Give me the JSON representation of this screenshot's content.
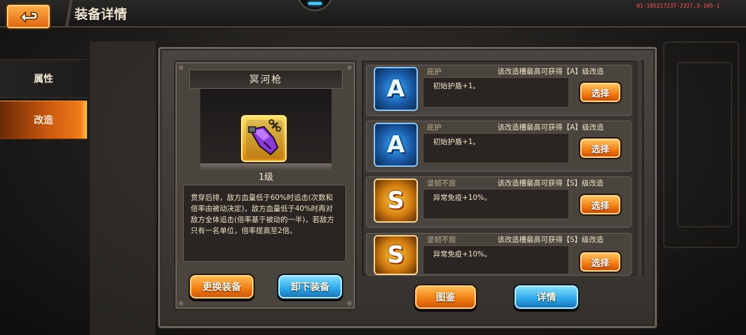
{
  "header": {
    "title": "装备详情",
    "version": "01-105217237-2327,3-105-1"
  },
  "sidebar": {
    "items": [
      {
        "label": "属性",
        "active": false
      },
      {
        "label": "改造",
        "active": true
      }
    ]
  },
  "equipment": {
    "name": "冥河枪",
    "level": "1级",
    "description": "贯穿后排，敌方血量低于60%时追击(次数和倍率由被动决定)，敌方血量低于40%时再对敌方全体追击(倍率基于被动的一半)，若敌方只有一名单位，倍率提高至2倍。"
  },
  "buttons": {
    "replace": "更换装备",
    "unequip": "卸下装备",
    "gallery": "图鉴",
    "details": "详情"
  },
  "slots": [
    {
      "grade": "A",
      "title": "庇护",
      "hint": "该改造槽最高可获得【A】级改造",
      "effect": "初始护盾+1。",
      "button": "选择"
    },
    {
      "grade": "A",
      "title": "庇护",
      "hint": "该改造槽最高可获得【A】级改造",
      "effect": "初始护盾+1。",
      "button": "选择"
    },
    {
      "grade": "S",
      "title": "坚韧不屈",
      "hint": "该改造槽最高可获得【S】级改造",
      "effect": "异常免疫+10%。",
      "button": "选择"
    },
    {
      "grade": "S",
      "title": "坚韧不屈",
      "hint": "该改造槽最高可获得【S】级改造",
      "effect": "异常免疫+10%。",
      "button": "选择"
    }
  ],
  "colors": {
    "accent_orange": "#f07a12",
    "accent_blue": "#2aa6e8",
    "grade_a": "#1a5aa8",
    "grade_s": "#d07a0e"
  }
}
